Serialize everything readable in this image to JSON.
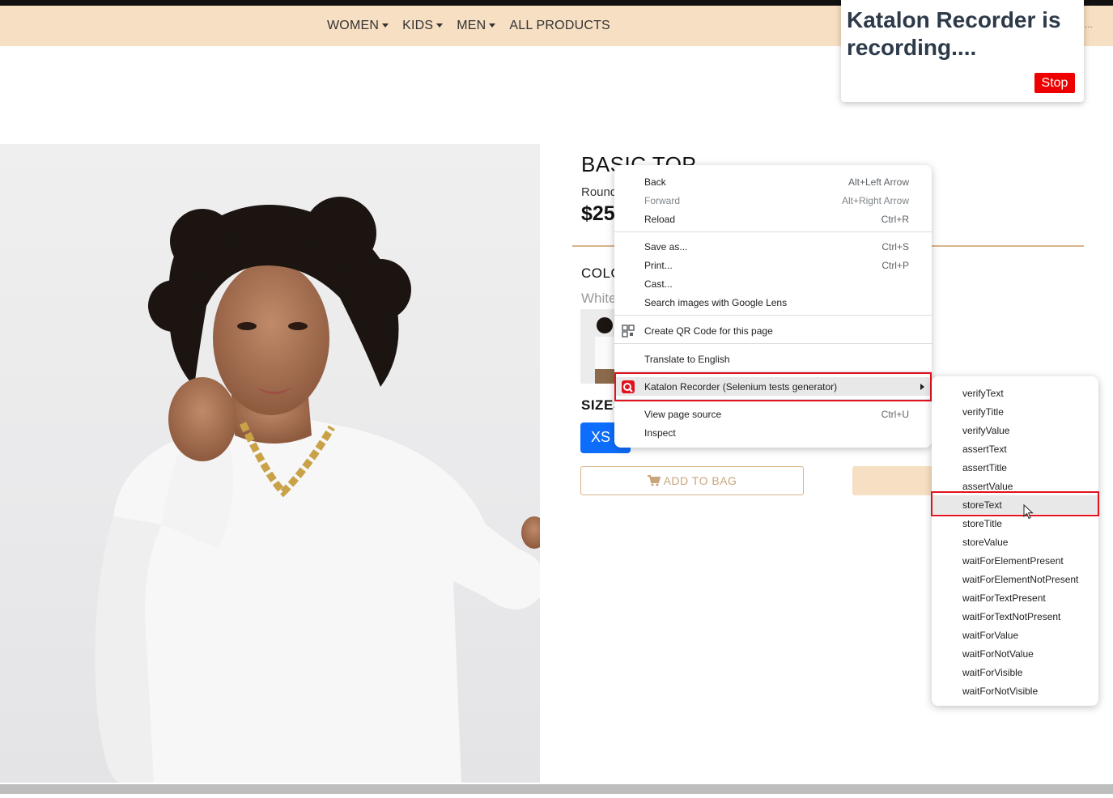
{
  "nav": {
    "items": [
      {
        "label": "WOMEN",
        "dropdown": true
      },
      {
        "label": "KIDS",
        "dropdown": true
      },
      {
        "label": "MEN",
        "dropdown": true
      },
      {
        "label": "ALL PRODUCTS",
        "dropdown": false
      }
    ],
    "overflow": "..."
  },
  "product": {
    "title": "BASIC TOP",
    "subtitle": "Round",
    "price": "$25",
    "color_label": "COLOR",
    "color_value": "White",
    "sizes_label": "SIZES",
    "selected_size": "XS",
    "add_to_bag_label": "ADD TO BAG"
  },
  "katalon": {
    "title": "Katalon Recorder is recording....",
    "stop_label": "Stop",
    "stop_color": "#ee0000"
  },
  "context_menu": {
    "items": [
      {
        "label": "Back",
        "shortcut": "Alt+Left Arrow",
        "disabled": false
      },
      {
        "label": "Forward",
        "shortcut": "Alt+Right Arrow",
        "disabled": true
      },
      {
        "label": "Reload",
        "shortcut": "Ctrl+R",
        "disabled": false
      },
      {
        "label": "Save as...",
        "shortcut": "Ctrl+S",
        "disabled": false
      },
      {
        "label": "Print...",
        "shortcut": "Ctrl+P",
        "disabled": false
      },
      {
        "label": "Cast...",
        "shortcut": "",
        "disabled": false
      },
      {
        "label": "Search images with Google Lens",
        "shortcut": "",
        "disabled": false
      },
      {
        "label": "Create QR Code for this page",
        "shortcut": "",
        "disabled": false,
        "icon": "qr-code-icon"
      },
      {
        "label": "Translate to English",
        "shortcut": "",
        "disabled": false
      },
      {
        "label": "Katalon Recorder (Selenium tests generator)",
        "shortcut": "",
        "disabled": false,
        "icon": "katalon-icon",
        "submenu": true
      },
      {
        "label": "View page source",
        "shortcut": "Ctrl+U",
        "disabled": false
      },
      {
        "label": "Inspect",
        "shortcut": "",
        "disabled": false
      }
    ]
  },
  "submenu": {
    "items": [
      "verifyText",
      "verifyTitle",
      "verifyValue",
      "assertText",
      "assertTitle",
      "assertValue",
      "storeText",
      "storeTitle",
      "storeValue",
      "waitForElementPresent",
      "waitForElementNotPresent",
      "waitForTextPresent",
      "waitForTextNotPresent",
      "waitForValue",
      "waitForNotValue",
      "waitForVisible",
      "waitForNotVisible"
    ],
    "highlighted": "storeText"
  },
  "colors": {
    "navbar": "#f7dfc3",
    "accent": "#d8b48a",
    "size_button": "#0d6efd",
    "highlight_box": "#e0121e"
  }
}
